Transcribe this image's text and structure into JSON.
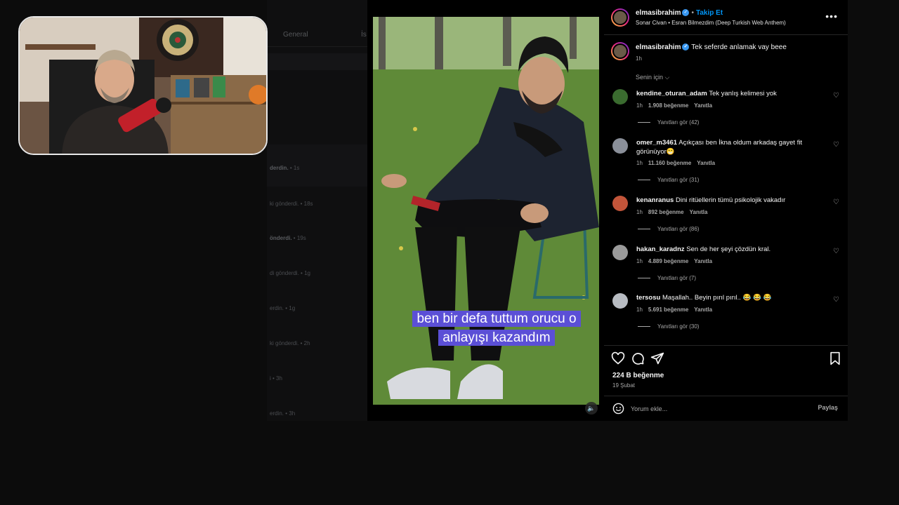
{
  "background": {
    "tabs": [
      "General",
      "İs"
    ],
    "notifications": [
      {
        "text": "derdin.",
        "time": "• 1s"
      },
      {
        "text": "ki gönderdi.",
        "time": "• 18s"
      },
      {
        "text": "önderdi.",
        "time": "• 19s"
      },
      {
        "text": "di gönderdi.",
        "time": "• 1g"
      },
      {
        "text": "erdin.",
        "time": "• 1g"
      },
      {
        "text": "ki gönderdi.",
        "time": "• 2h"
      },
      {
        "text": "i",
        "time": "• 3h"
      },
      {
        "text": "erdin.",
        "time": "• 3h"
      }
    ]
  },
  "video": {
    "caption_line1": "ben bir defa tuttum orucu o",
    "caption_line2": "anlayışı kazandım",
    "mute_icon": "speaker-icon"
  },
  "post": {
    "author": "elmasibrahim",
    "follow_label": "Takip Et",
    "audio": "Sonar Civan • Esran Bilmezdim (Deep Turkish Web Anthem)",
    "caption_user": "elmasibrahim",
    "caption_text": "Tek seferde anlamak vay beee",
    "caption_time": "1h",
    "sort_label": "Senin için",
    "likes": "224 B beğenme",
    "date": "19 Şubat",
    "comment_placeholder": "Yorum ekle...",
    "post_label": "Paylaş"
  },
  "comments": [
    {
      "user": "kendine_oturan_adam",
      "text": "Tek yanlış kelimesi yok",
      "time": "1h",
      "likes": "1.908 beğenme",
      "reply": "Yanıtla",
      "replies": "Yanıtları gör (42)",
      "color": "#3a6b2f"
    },
    {
      "user": "omer_m3461",
      "text": "Açıkçası ben İkna oldum arkadaş gayet fit görünüyor😁",
      "time": "1h",
      "likes": "11.160 beğenme",
      "reply": "Yanıtla",
      "replies": "Yanıtları gör (31)",
      "color": "#8a8f99"
    },
    {
      "user": "kenanranus",
      "text": "Dini ritüellerin tümü psikolojik vakadır",
      "time": "1h",
      "likes": "892 beğenme",
      "reply": "Yanıtla",
      "replies": "Yanıtları gör (86)",
      "color": "#c2553a"
    },
    {
      "user": "hakan_karadnz",
      "text": "Sen de her şeyi çözdün kral.",
      "time": "1h",
      "likes": "4.889 beğenme",
      "reply": "Yanıtla",
      "replies": "Yanıtları gör (7)",
      "color": "#9a9a9a"
    },
    {
      "user": "tersosu",
      "text": "Maşallah.. Beyin pırıl pırıl.. 😂 😂 😂",
      "time": "1h",
      "likes": "5.691 beğenme",
      "reply": "Yanıtla",
      "replies": "Yanıtları gör (30)",
      "color": "#b8bcc2"
    }
  ]
}
